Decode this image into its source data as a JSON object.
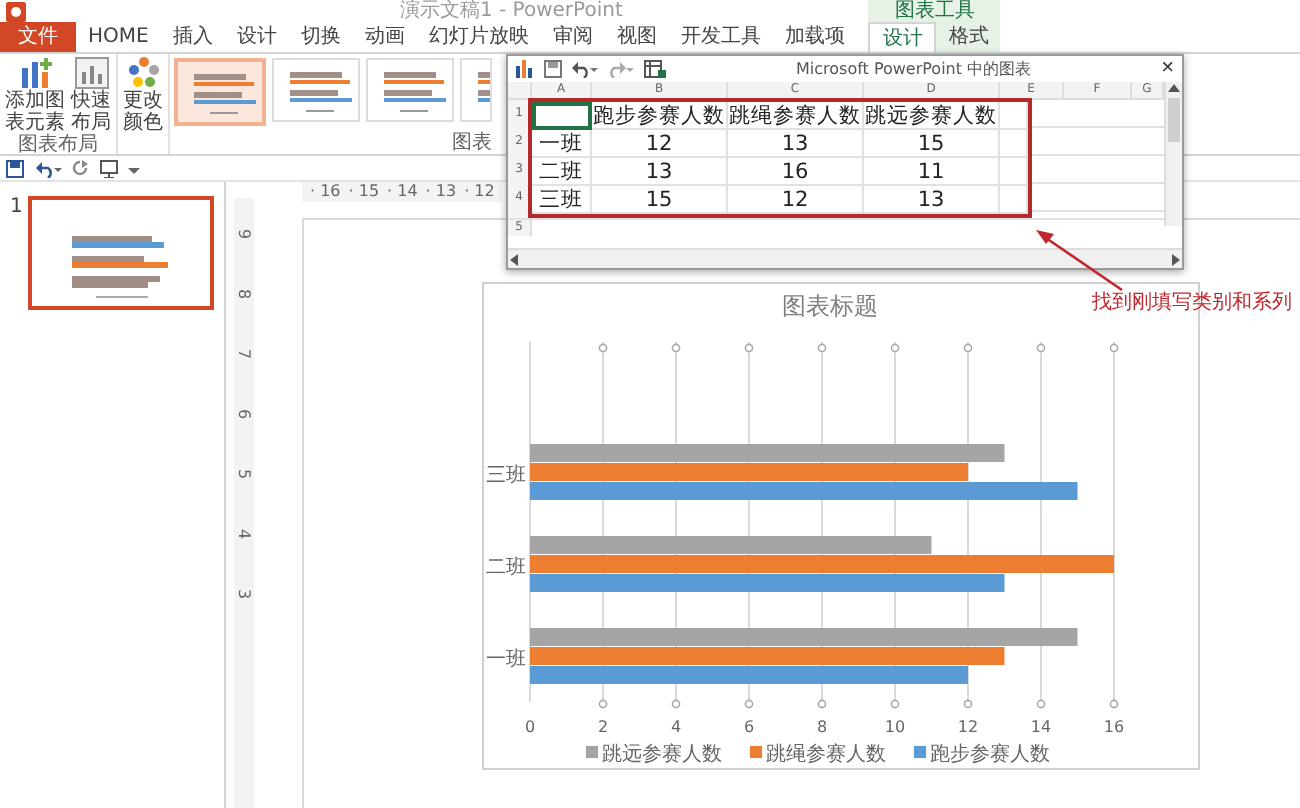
{
  "title_bar": {
    "title": "演示文稿1 - PowerPoint"
  },
  "ribbon": {
    "tabs": [
      {
        "label": "文件",
        "kind": "file",
        "selected": false
      },
      {
        "label": "HOME",
        "kind": "tab",
        "selected": false
      },
      {
        "label": "插入",
        "kind": "tab",
        "selected": false
      },
      {
        "label": "设计",
        "kind": "tab",
        "selected": false
      },
      {
        "label": "切换",
        "kind": "tab",
        "selected": false
      },
      {
        "label": "动画",
        "kind": "tab",
        "selected": false
      },
      {
        "label": "幻灯片放映",
        "kind": "tab",
        "selected": false
      },
      {
        "label": "审阅",
        "kind": "tab",
        "selected": false
      },
      {
        "label": "视图",
        "kind": "tab",
        "selected": false
      },
      {
        "label": "开发工具",
        "kind": "tab",
        "selected": false
      },
      {
        "label": "加载项",
        "kind": "tab",
        "selected": false
      }
    ],
    "context_label": "图表工具",
    "context_tabs": [
      {
        "label": "设计",
        "selected": true
      },
      {
        "label": "格式",
        "selected": false
      }
    ],
    "layout_buttons": [
      {
        "label": "添加图表元素",
        "kind": "add-element"
      },
      {
        "label": "快速布局",
        "kind": "layout"
      }
    ],
    "layout_group_label": "图表布局",
    "color_button": {
      "label": "更改颜色"
    },
    "styles": [
      {
        "selected": true
      },
      {
        "selected": false
      },
      {
        "selected": false
      },
      {
        "selected": false
      }
    ],
    "styles_group_label": "图表"
  },
  "slides_pane": {
    "slides": [
      {
        "number": "1",
        "selected": true
      }
    ]
  },
  "ruler": {
    "top_labels": [
      "· 16",
      "· 15",
      "· 14",
      "· 13",
      "· 12"
    ],
    "side_labels": [
      "9",
      "8",
      "7",
      "6",
      "5",
      "4",
      "3"
    ]
  },
  "chart": {
    "chart_data": {
      "type": "bar",
      "orientation": "horizontal",
      "title": "图表标题",
      "categories": [
        "三班",
        "二班",
        "一班"
      ],
      "series": [
        {
          "name": "跑步参赛人数",
          "color": "#5b9bd5",
          "values": [
            15,
            13,
            12
          ]
        },
        {
          "name": "跳绳参赛人数",
          "color": "#ed7d31",
          "values": [
            12,
            16,
            13
          ]
        },
        {
          "name": "跳远参赛人数",
          "color": "#a5a5a5",
          "values": [
            13,
            11,
            15
          ]
        }
      ],
      "xlim": [
        0,
        16
      ],
      "xticks": [
        0,
        2,
        4,
        6,
        8,
        10,
        12,
        14,
        16
      ],
      "grid": true,
      "legend": true
    }
  },
  "excel": {
    "title": "Microsoft PowerPoint 中的图表",
    "close": "×",
    "columns": [
      "A",
      "B",
      "C",
      "D",
      "E",
      "F",
      "G"
    ],
    "header_row_number": "1",
    "header_cell_selected": true,
    "headers": [
      "跑步参赛人数",
      "跳绳参赛人数",
      "跳远参赛人数"
    ],
    "rows": [
      {
        "number": "2",
        "label": "一班",
        "values": [
          "12",
          "13",
          "15"
        ]
      },
      {
        "number": "3",
        "label": "二班",
        "values": [
          "13",
          "16",
          "11"
        ]
      },
      {
        "number": "4",
        "label": "三班",
        "values": [
          "15",
          "12",
          "13"
        ]
      }
    ],
    "blank_row_numbers": [
      "5"
    ]
  },
  "annotation": {
    "text": "找到刚填写类别和系列"
  }
}
